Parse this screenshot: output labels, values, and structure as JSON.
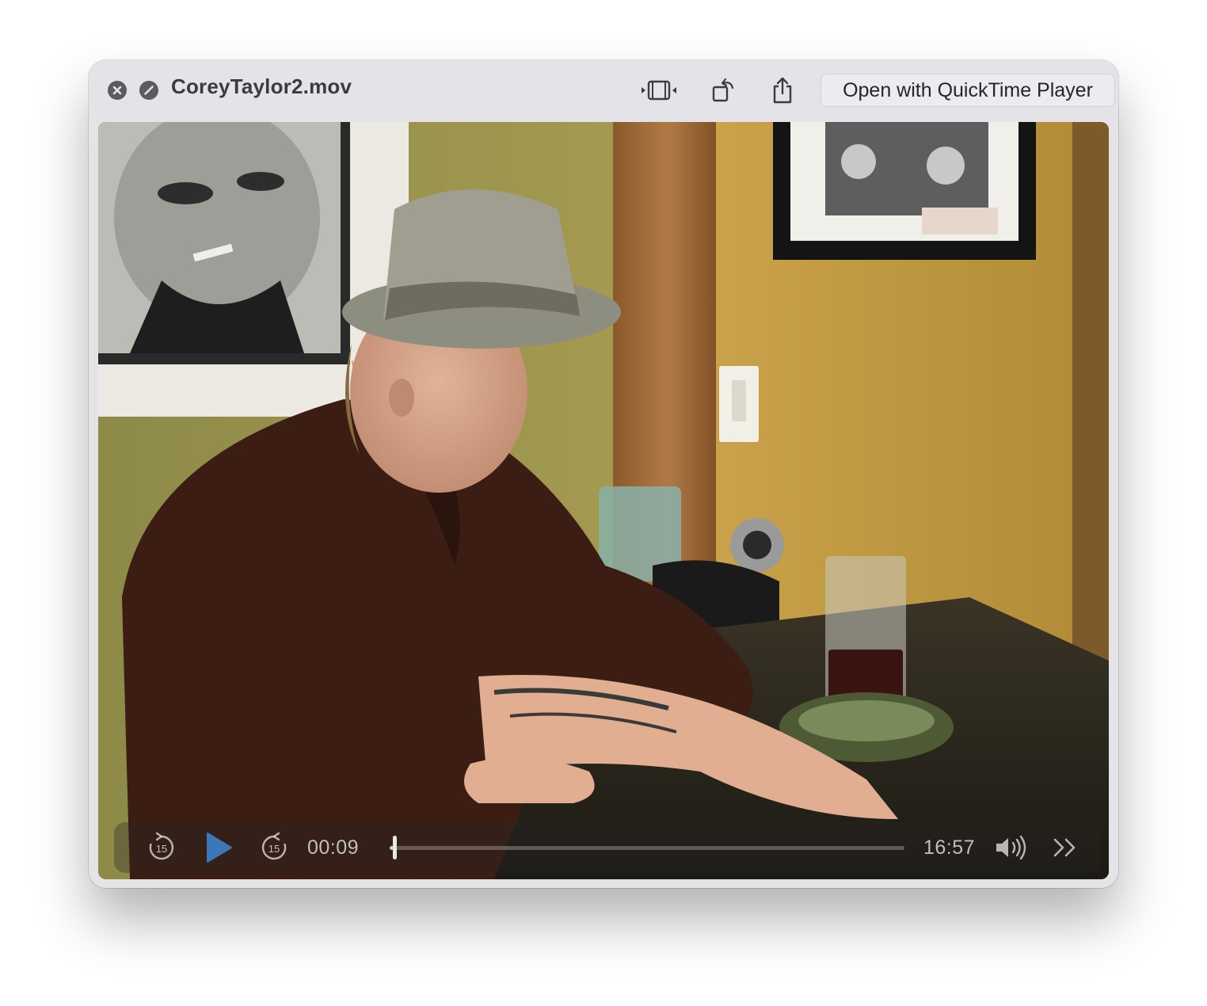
{
  "window": {
    "title": "CoreyTaylor2.mov",
    "open_button_label": "Open with QuickTime Player"
  },
  "toolbar": {
    "icons": [
      "close-icon",
      "no-entry-icon",
      "trim-icon",
      "rotate-icon",
      "share-icon"
    ]
  },
  "player": {
    "skip_back_label": "15",
    "skip_forward_label": "15",
    "current_time": "00:09",
    "duration": "16:57",
    "progress": 0.009,
    "accent_color": "#3a78b8"
  }
}
